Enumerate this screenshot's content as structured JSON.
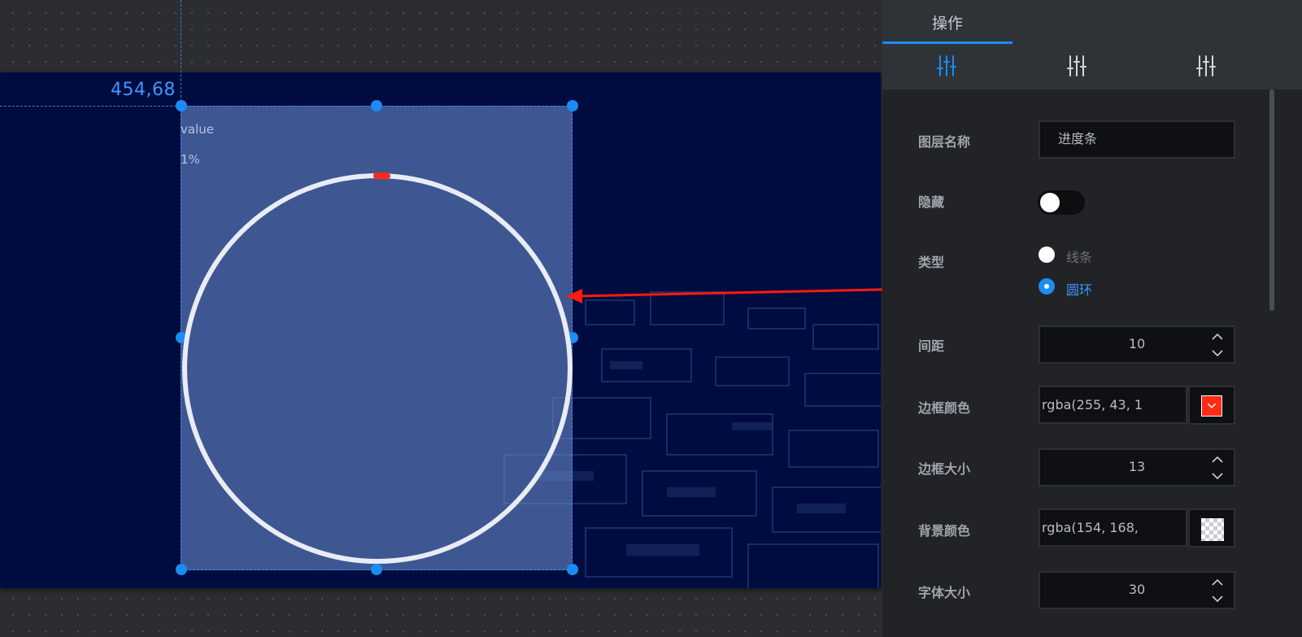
{
  "canvas": {
    "coords": "454,68",
    "component": {
      "value_label": "value",
      "percent_label": "1%"
    }
  },
  "panel": {
    "header": {
      "tab_label": "操作",
      "icons": [
        "sliders-icon",
        "sliders-icon",
        "sliders-icon"
      ]
    },
    "fields": {
      "layer_name": {
        "label": "图层名称",
        "value": "进度条"
      },
      "hidden": {
        "label": "隐藏",
        "enabled": false
      },
      "type": {
        "label": "类型",
        "options": [
          "线条",
          "圆环"
        ],
        "selected": "圆环"
      },
      "spacing": {
        "label": "间距",
        "value": "10"
      },
      "border_color": {
        "label": "边框颜色",
        "value": "rgba(255, 43, 1",
        "swatch": "#ff2b17"
      },
      "border_size": {
        "label": "边框大小",
        "value": "13"
      },
      "background_color": {
        "label": "背景颜色",
        "value": "rgba(154, 168,",
        "swatch": "transparent"
      },
      "font_size": {
        "label": "字体大小",
        "value": "30"
      }
    }
  },
  "colors": {
    "accent": "#1b8cf5",
    "annotation_red": "#ff1a0d",
    "canvas_bg": "#000c3f"
  }
}
